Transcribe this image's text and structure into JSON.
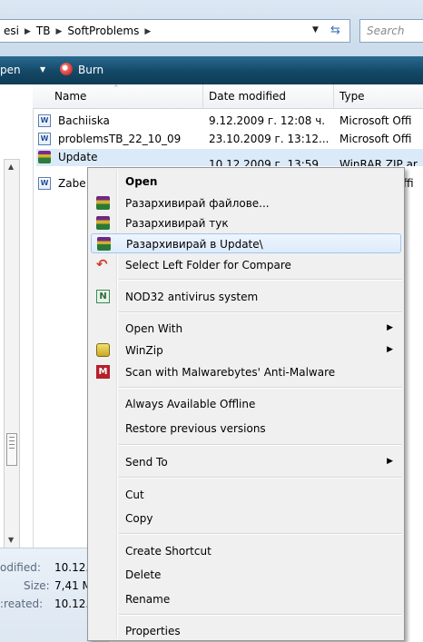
{
  "address": {
    "crumbs": [
      "esi",
      "TB",
      "SoftProblems"
    ],
    "search_placeholder": "Search"
  },
  "toolbar": {
    "open_label": "pen",
    "burn_label": "Burn"
  },
  "columns": {
    "name": "Name",
    "date": "Date modified",
    "type": "Type"
  },
  "files": [
    {
      "name": "Bachiiska",
      "date": "9.12.2009 г. 12:08 ч.",
      "type": "Microsoft Offi",
      "icon": "word-doc-icon"
    },
    {
      "name": "problemsTB_22_10_09",
      "date": "23.10.2009 г. 13:12...",
      "type": "Microsoft Offi",
      "icon": "word-doc-icon"
    },
    {
      "name": "Update",
      "date": "10.12.2009 г. 13:59",
      "type": "WinRAR ZIP ar",
      "icon": "winrar-icon"
    },
    {
      "name": "Zabe",
      "date": "",
      "type": "ffi",
      "icon": "word-doc-icon"
    }
  ],
  "details": {
    "modified_label": "odified:",
    "modified_value": "10.12.",
    "size_label": "Size:",
    "size_value": "7,41 M",
    "created_label": ":reated:",
    "created_value": "10.12."
  },
  "menu": {
    "open": "Open",
    "extract_files": "Разархивирай файлове...",
    "extract_here": "Разархивирай тук",
    "extract_to_folder": "Разархивирай в Update\\",
    "compare": "Select Left Folder for Compare",
    "nod32": "NOD32 antivirus system",
    "open_with": "Open With",
    "winzip": "WinZip",
    "malwarebytes": "Scan with Malwarebytes' Anti-Malware",
    "offline": "Always Available Offline",
    "restore": "Restore previous versions",
    "send_to": "Send To",
    "cut": "Cut",
    "copy": "Copy",
    "create_shortcut": "Create Shortcut",
    "delete": "Delete",
    "rename": "Rename",
    "properties": "Properties"
  },
  "colors": {
    "toolbar": "#134866",
    "selection": "#dbeaf9",
    "menu_bg": "#f0f0f0",
    "compare_arrow": "#d43a2a"
  }
}
